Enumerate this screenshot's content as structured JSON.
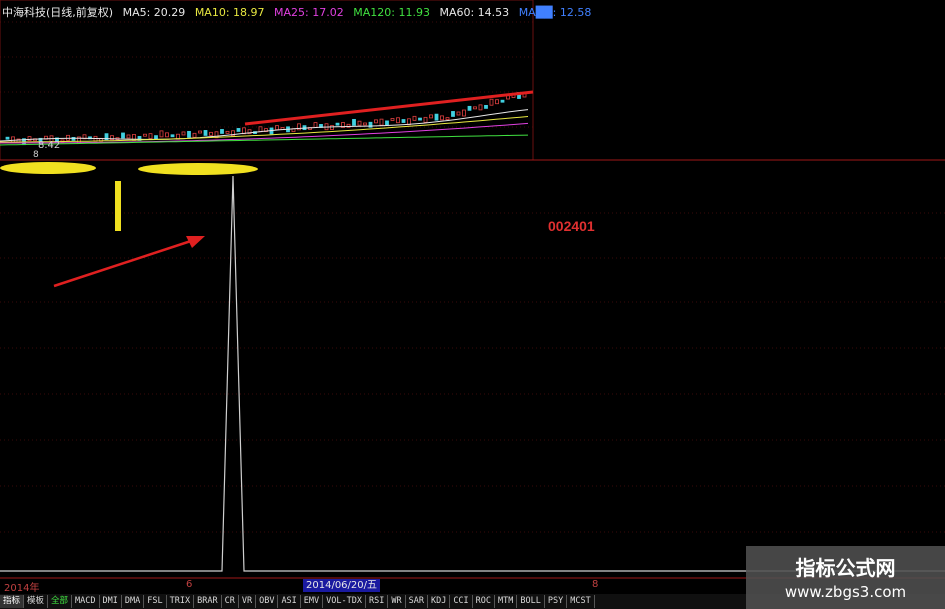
{
  "header": {
    "stock_title": "中海科技(日线,前复权)",
    "ma5": "MA5: 20.29",
    "ma10": "MA10: 18.97",
    "ma25": "MA25: 17.02",
    "ma120": "MA120: 11.93",
    "ma60": "MA60: 14.53",
    "ma_extra": "MA██: 12.58"
  },
  "colors": {
    "ma5": "#e8e8e8",
    "ma10": "#e8e840",
    "ma25": "#e040e0",
    "ma120": "#40e040",
    "ma60": "#e8e8e8",
    "ma_extra": "#4080ff",
    "trend_arrow": "#e02020",
    "highlight": "#f0e020",
    "spike": "#d0d0d0"
  },
  "price_labels": {
    "low": "8.42",
    "low_b": "8"
  },
  "annotation": {
    "stock_code": "002401"
  },
  "axis": {
    "year": "2014年",
    "month_6": "6",
    "selected_date": "2014/06/20/五",
    "month_8": "8"
  },
  "indicator_tabs": [
    "指标",
    "模板",
    "全部",
    "MACD",
    "DMI",
    "DMA",
    "FSL",
    "TRIX",
    "BRAR",
    "CR",
    "VR",
    "OBV",
    "ASI",
    "EMV",
    "VOL-TDX",
    "RSI",
    "WR",
    "SAR",
    "KDJ",
    "CCI",
    "ROC",
    "MTM",
    "BOLL",
    "PSY",
    "MCST"
  ],
  "watermark": {
    "title": "指标公式网",
    "url": "www.zbgs3.com"
  }
}
